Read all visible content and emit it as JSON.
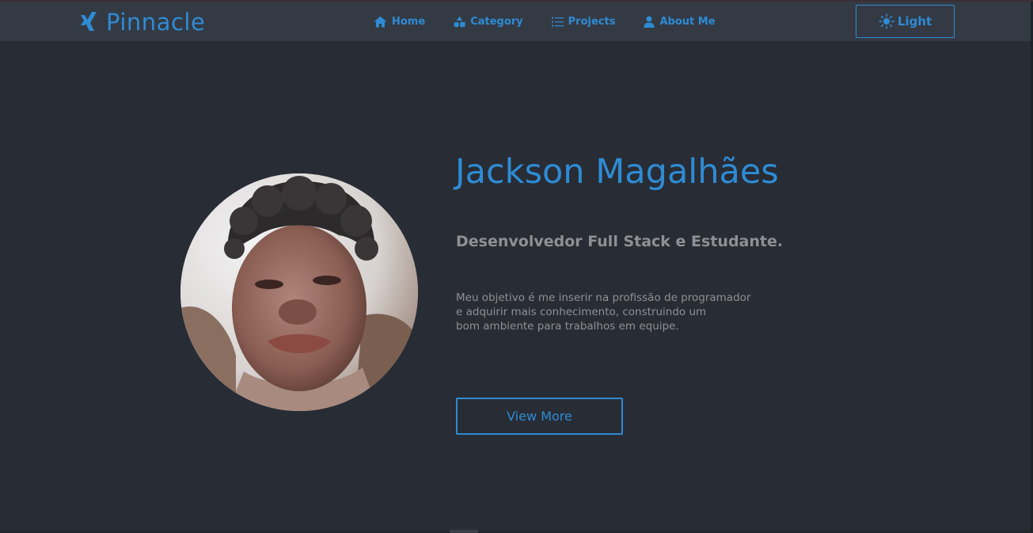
{
  "brand": {
    "name": "Pinnacle",
    "icon": "xing-logo-icon"
  },
  "nav": {
    "items": [
      {
        "label": "Home",
        "icon": "home-icon"
      },
      {
        "label": "Category",
        "icon": "shapes-icon"
      },
      {
        "label": "Projects",
        "icon": "list-icon"
      },
      {
        "label": "About Me",
        "icon": "user-icon"
      }
    ]
  },
  "theme_toggle": {
    "label": "Light",
    "icon": "sun-icon"
  },
  "hero": {
    "name": "Jackson Magalhães",
    "role": "Desenvolvedor Full Stack e Estudante.",
    "description_lines": [
      "Meu objetivo é me inserir na profissão de programador",
      "e adquirir mais conhecimento, construindo um",
      "bom ambiente para trabalhos em equipe."
    ],
    "cta_label": "View More"
  },
  "colors": {
    "background": "#282c34",
    "navbar": "#343a44",
    "accent": "#2e8bd4",
    "muted_text": "#8d9096"
  }
}
